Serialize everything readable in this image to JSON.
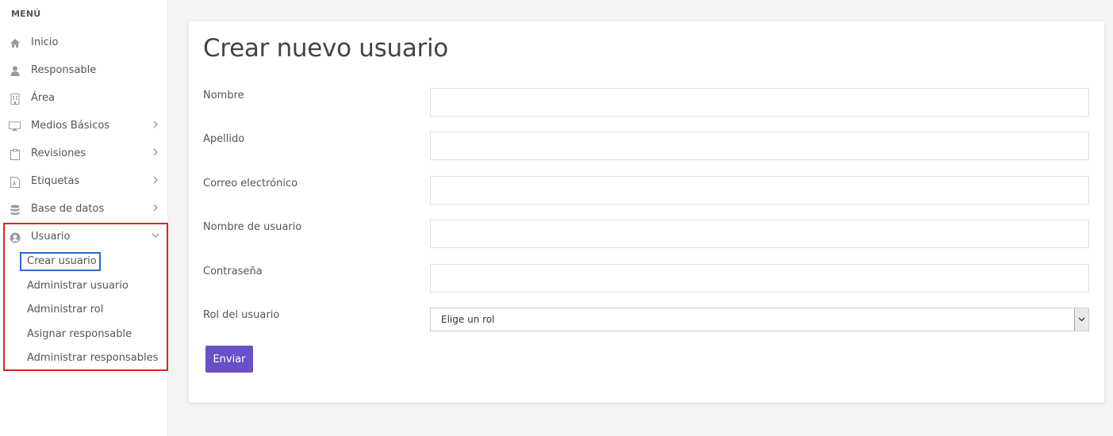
{
  "sidebar": {
    "menu_title": "MENÚ",
    "items": [
      {
        "label": "Inicio",
        "icon": "home-icon"
      },
      {
        "label": "Responsable",
        "icon": "user-icon"
      },
      {
        "label": "Área",
        "icon": "building-icon"
      },
      {
        "label": "Medios Básicos",
        "icon": "monitor-icon",
        "has_submenu": true
      },
      {
        "label": "Revisiones",
        "icon": "clipboard-icon",
        "has_submenu": true
      },
      {
        "label": "Etiquetas",
        "icon": "pdf-file-icon",
        "has_submenu": true
      },
      {
        "label": "Base de datos",
        "icon": "database-icon",
        "has_submenu": true
      },
      {
        "label": "Usuario",
        "icon": "user-circle-icon",
        "expanded": true
      }
    ],
    "usuario_submenu": [
      {
        "label": "Crear usuario",
        "active": true
      },
      {
        "label": "Administrar usuario"
      },
      {
        "label": "Administrar rol"
      },
      {
        "label": "Asignar responsable"
      },
      {
        "label": "Administrar responsables"
      }
    ]
  },
  "main": {
    "title": "Crear nuevo usuario",
    "fields": [
      {
        "label": "Nombre",
        "value": ""
      },
      {
        "label": "Apellido",
        "value": ""
      },
      {
        "label": "Correo electrónico",
        "value": ""
      },
      {
        "label": "Nombre de usuario",
        "value": ""
      },
      {
        "label": "Contraseña",
        "value": ""
      }
    ],
    "role_field": {
      "label": "Rol del usuario",
      "selected": "Elige un rol"
    },
    "submit_label": "Enviar"
  },
  "colors": {
    "submit_button": "#6a4fc9",
    "highlight_red": "#e02424",
    "highlight_blue": "#2d67d8"
  }
}
